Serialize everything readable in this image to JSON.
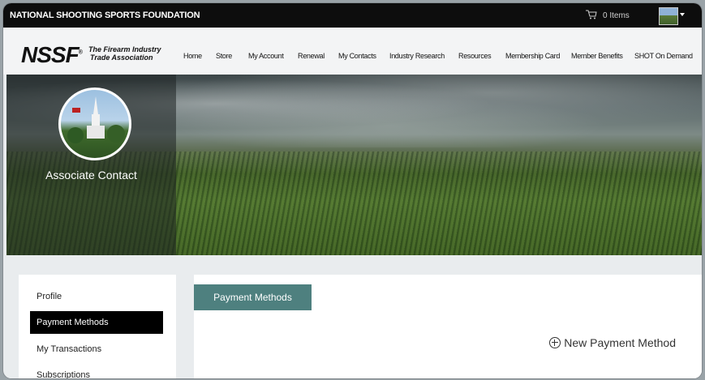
{
  "topbar": {
    "org_name": "NATIONAL SHOOTING SPORTS FOUNDATION",
    "cart_count": "0 Items"
  },
  "header": {
    "logo": "NSSF",
    "tagline_line1": "The Firearm Industry",
    "tagline_line2": "Trade Association"
  },
  "nav": {
    "items": [
      {
        "label": "Home"
      },
      {
        "label": "Store"
      },
      {
        "label": "My Account"
      },
      {
        "label": "Renewal"
      },
      {
        "label": "My Contacts"
      },
      {
        "label": "Industry Research"
      },
      {
        "label": "Resources"
      },
      {
        "label": "Membership Card"
      },
      {
        "label": "Member Benefits"
      },
      {
        "label": "SHOT On Demand"
      }
    ]
  },
  "profile": {
    "name": "Associate Contact"
  },
  "sidebar": {
    "items": [
      {
        "label": "Profile"
      },
      {
        "label": "Payment Methods"
      },
      {
        "label": "My Transactions"
      },
      {
        "label": "Subscriptions"
      }
    ],
    "active": "Payment Methods"
  },
  "main": {
    "tab": "Payment Methods",
    "new_button": "New Payment Method"
  },
  "colors": {
    "tab_accent": "#4e807f",
    "topbar": "#0d0d0d",
    "active_item": "#000000"
  }
}
